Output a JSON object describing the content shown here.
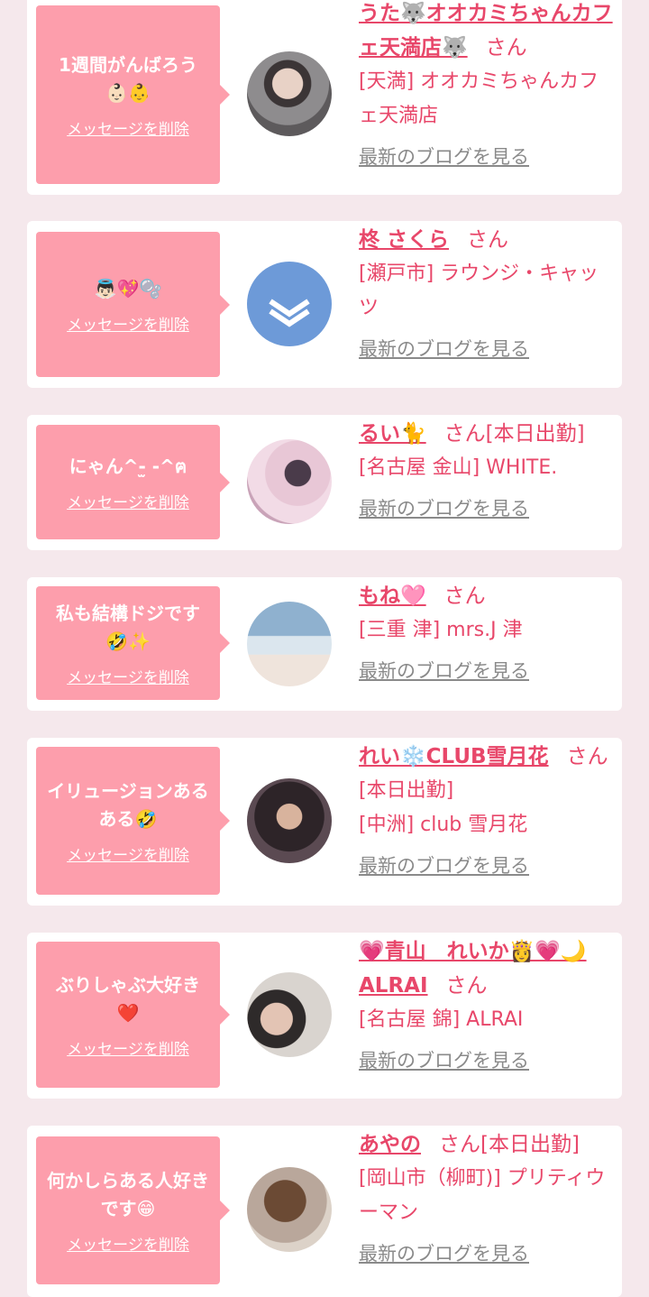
{
  "colors": {
    "accent": "#e8476a",
    "bubble": "#fd9eac",
    "background": "#f5e8ec"
  },
  "items": [
    {
      "message": "1週間がんばろう 👶🏻👶",
      "delete_label": "メッセージを削除",
      "name": "うた🐺オオカミちゃんカフェ天満店🐺",
      "san": "さん",
      "shop": "[天満] オオカミちゃんカフェ天満店",
      "blog_label": "最新のブログを見る"
    },
    {
      "message": "👼🏻💖🫧",
      "delete_label": "メッセージを削除",
      "name": "柊 さくら",
      "san": "さん",
      "shop": "[瀬戸市] ラウンジ・キャッツ",
      "blog_label": "最新のブログを見る"
    },
    {
      "message": "にゃん^-̫ -^ฅ",
      "delete_label": "メッセージを削除",
      "name": "るい🐈",
      "san": "さん[本日出勤]",
      "shop": "[名古屋 金山] WHITE.",
      "blog_label": "最新のブログを見る"
    },
    {
      "message": "私も結構ドジです🤣✨",
      "delete_label": "メッセージを削除",
      "name": "もね🩷",
      "san": "さん",
      "shop": "[三重 津] mrs.J 津",
      "blog_label": "最新のブログを見る"
    },
    {
      "message": "イリュージョンあるある🤣",
      "delete_label": "メッセージを削除",
      "name": "れい❄️CLUB雪月花",
      "san": "さん",
      "status": "[本日出勤]",
      "shop": "[中洲] club 雪月花",
      "blog_label": "最新のブログを見る"
    },
    {
      "message": "ぶりしゃぶ大好き❤️",
      "delete_label": "メッセージを削除",
      "name": "💗青山　れいか👸💗🌙 ALRAI",
      "san": "さん",
      "shop": "[名古屋 錦] ALRAI",
      "blog_label": "最新のブログを見る"
    },
    {
      "message": "何かしらある人好きです😁",
      "delete_label": "メッセージを削除",
      "name": "あやの",
      "san": "さん[本日出勤]",
      "shop": "[岡山市（柳町)] プリティウーマン",
      "blog_label": "最新のブログを見る"
    }
  ]
}
